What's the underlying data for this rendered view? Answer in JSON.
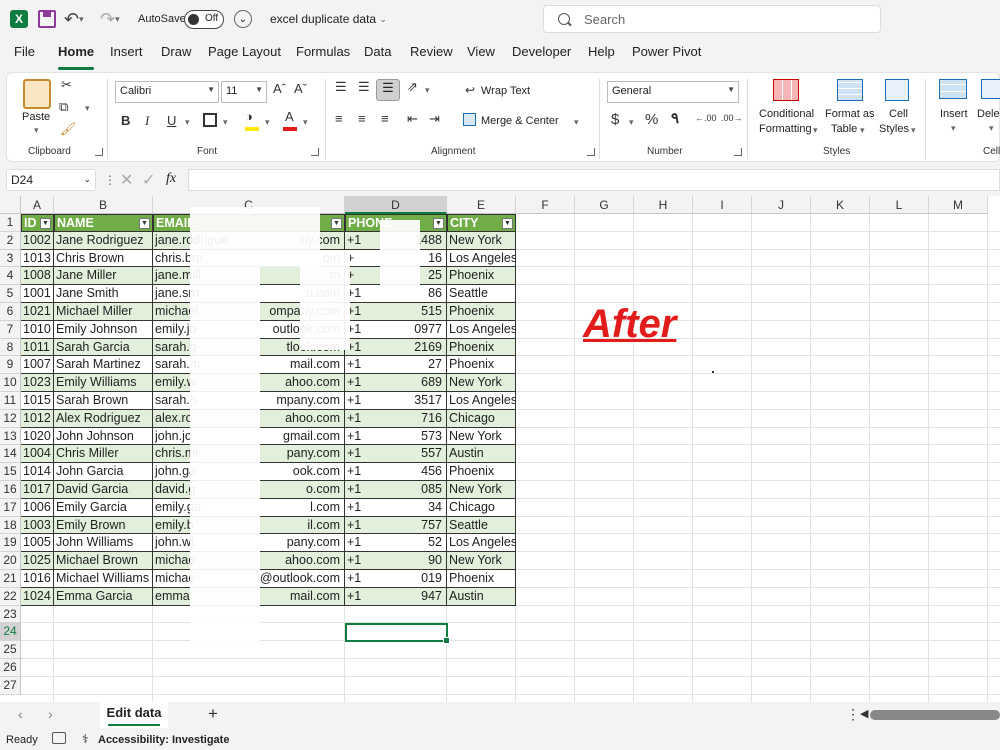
{
  "titlebar": {
    "app_icon": "X",
    "autosave_label": "AutoSave",
    "autosave_state": "Off",
    "doc_title": "excel duplicate data",
    "search_placeholder": "Search"
  },
  "tabs": [
    "File",
    "Home",
    "Insert",
    "Draw",
    "Page Layout",
    "Formulas",
    "Data",
    "Review",
    "View",
    "Developer",
    "Help",
    "Power Pivot"
  ],
  "active_tab": "Home",
  "ribbon": {
    "clipboard": {
      "paste": "Paste",
      "label": "Clipboard"
    },
    "font": {
      "name": "Calibri",
      "size": "11",
      "label": "Font"
    },
    "alignment": {
      "wrap": "Wrap Text",
      "merge": "Merge & Center",
      "label": "Alignment"
    },
    "number": {
      "format": "General",
      "label": "Number"
    },
    "styles": {
      "conditional_1": "Conditional",
      "conditional_2": "Formatting",
      "format_table_1": "Format as",
      "format_table_2": "Table",
      "cell_styles_1": "Cell",
      "cell_styles_2": "Styles",
      "label": "Styles"
    },
    "cells": {
      "insert": "Insert",
      "delete": "Dele",
      "label": "Cells"
    }
  },
  "formula_bar": {
    "name_box": "D24",
    "fx": "fx",
    "value": ""
  },
  "columns": [
    "A",
    "B",
    "C",
    "D",
    "E",
    "F",
    "G",
    "H",
    "I",
    "J",
    "K",
    "L",
    "M"
  ],
  "rows": [
    "1",
    "2",
    "3",
    "4",
    "5",
    "6",
    "7",
    "8",
    "9",
    "10",
    "11",
    "12",
    "13",
    "14",
    "15",
    "16",
    "17",
    "18",
    "19",
    "20",
    "21",
    "22",
    "23",
    "24",
    "25",
    "26",
    "27"
  ],
  "table": {
    "headers": [
      "ID",
      "NAME",
      "EMAIL",
      "PHONE",
      "CITY"
    ],
    "rows": [
      [
        "1002",
        "Jane Rodriguez",
        "jane.rodrigue",
        "ny.com",
        "+1",
        "1488",
        "New York"
      ],
      [
        "1013",
        "Chris Brown",
        "chris.bro",
        "om",
        "+",
        "16",
        "Los Angeles"
      ],
      [
        "1008",
        "Jane Miller",
        "jane.mill",
        "m",
        "+",
        "25",
        "Phoenix"
      ],
      [
        "1001",
        "Jane Smith",
        "jane.sm",
        "o.com",
        "+1",
        "86",
        "Seattle"
      ],
      [
        "1021",
        "Michael Miller",
        "michael",
        "ompany.com",
        "+1",
        "515",
        "Phoenix"
      ],
      [
        "1010",
        "Emily Johnson",
        "emily.jo",
        "outlook.com",
        "+1",
        "0977",
        "Los Angeles"
      ],
      [
        "1011",
        "Sarah Garcia",
        "sarah.g",
        "tlook.com",
        "+1",
        "2169",
        "Phoenix"
      ],
      [
        "1007",
        "Sarah Martinez",
        "sarah.m",
        "mail.com",
        "+1",
        "27",
        "Phoenix"
      ],
      [
        "1023",
        "Emily Williams",
        "emily.w",
        "ahoo.com",
        "+1",
        "689",
        "New York"
      ],
      [
        "1015",
        "Sarah Brown",
        "sarah.b",
        "mpany.com",
        "+1",
        "3517",
        "Los Angeles"
      ],
      [
        "1012",
        "Alex Rodriguez",
        "alex.ro",
        "ahoo.com",
        "+1",
        "716",
        "Chicago"
      ],
      [
        "1020",
        "John Johnson",
        "john.jo",
        "gmail.com",
        "+1",
        "573",
        "New York"
      ],
      [
        "1004",
        "Chris Miller",
        "chris.mi",
        "pany.com",
        "+1",
        "557",
        "Austin"
      ],
      [
        "1014",
        "John Garcia",
        "john.ga",
        "ook.com",
        "+1",
        "456",
        "Phoenix"
      ],
      [
        "1017",
        "David Garcia",
        "david.g",
        "o.com",
        "+1",
        "085",
        "New York"
      ],
      [
        "1006",
        "Emily Garcia",
        "emily.ga",
        "l.com",
        "+1",
        "34",
        "Chicago"
      ],
      [
        "1003",
        "Emily Brown",
        "emily.b",
        "il.com",
        "+1",
        "757",
        "Seattle"
      ],
      [
        "1005",
        "John Williams",
        "john.wi",
        "pany.com",
        "+1",
        "52",
        "Los Angeles"
      ],
      [
        "1025",
        "Michael Brown",
        "michae",
        "ahoo.com",
        "+1",
        "90",
        "New York"
      ],
      [
        "1016",
        "Michael Williams",
        "michae",
        "@outlook.com",
        "+1",
        "019",
        "Phoenix"
      ],
      [
        "1024",
        "Emma Garcia",
        "emma",
        "mail.com",
        "+1",
        "947",
        "Austin"
      ]
    ]
  },
  "annotation": "After",
  "sheet": {
    "tab": "Edit data",
    "add": "+"
  },
  "status": {
    "ready": "Ready",
    "accessibility": "Accessibility: Investigate"
  },
  "colors": {
    "accent": "#107c41",
    "header_fill": "#70ad47",
    "band_fill": "#e2efda",
    "after_red": "#e21b1b"
  }
}
